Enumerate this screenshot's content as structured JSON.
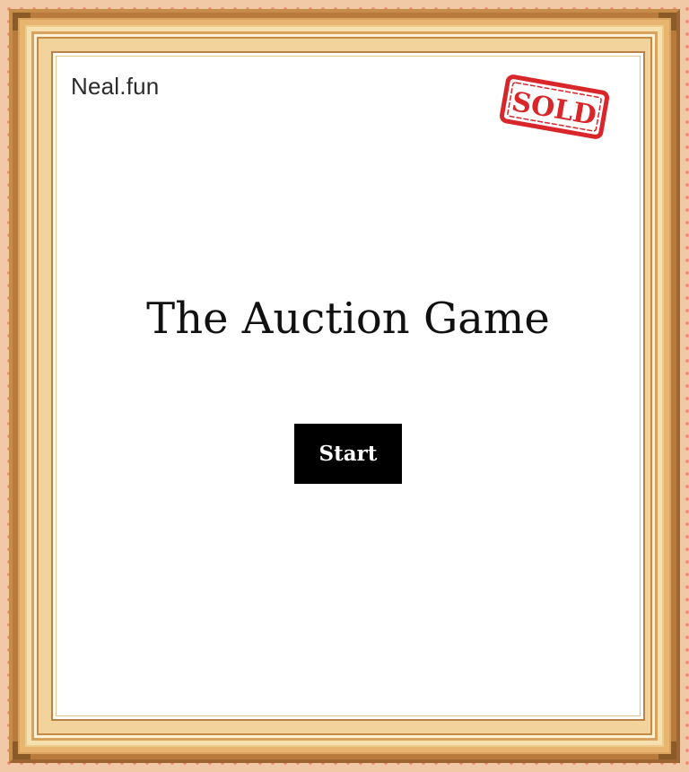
{
  "header": {
    "site_name": "Neal.fun"
  },
  "stamp": {
    "text": "SOLD",
    "color": "#d8262b",
    "icon": "sold-stamp-icon"
  },
  "main": {
    "title": "The Auction Game",
    "start_label": "Start"
  },
  "theme": {
    "frame_gold": "#e7b56f",
    "frame_dark": "#8a5a27",
    "background_dots": "#f08a74",
    "background": "#f2c9a6",
    "button_bg": "#000000",
    "button_text": "#ffffff"
  }
}
